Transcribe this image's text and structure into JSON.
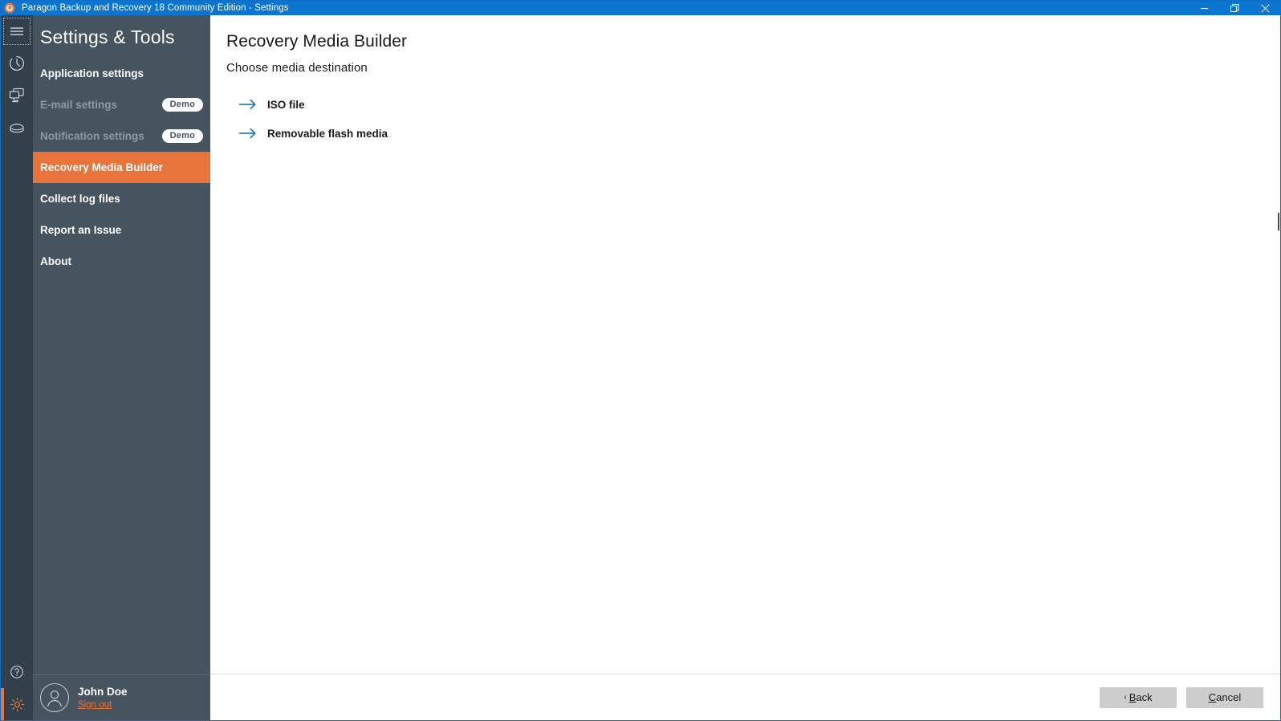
{
  "window": {
    "title": "Paragon Backup and Recovery 18 Community Edition - Settings",
    "app_icon": "paragon-logo-icon",
    "controls": {
      "minimize": "minimize-icon",
      "restore": "restore-icon",
      "close": "close-icon"
    },
    "accent_titlebar": "#0a76d2"
  },
  "icon_rail": {
    "top_items": [
      {
        "name": "menu-toggle",
        "icon": "hamburger-menu-icon",
        "focused": true
      },
      {
        "name": "history",
        "icon": "clock-history-icon",
        "focused": false
      },
      {
        "name": "backup-jobs",
        "icon": "monitor-screens-icon",
        "focused": false
      },
      {
        "name": "disks",
        "icon": "disk-drive-icon",
        "focused": false
      }
    ],
    "bottom_items": [
      {
        "name": "help",
        "icon": "help-question-icon",
        "active": false
      },
      {
        "name": "settings",
        "icon": "gear-icon",
        "active": true
      }
    ],
    "accent_color": "#e8743b"
  },
  "sidebar": {
    "heading": "Settings & Tools",
    "background": "#46545f",
    "active_color": "#e8743b",
    "items": [
      {
        "label": "Application settings",
        "state": "enabled",
        "badge": null
      },
      {
        "label": "E-mail settings",
        "state": "disabled",
        "badge": "Demo"
      },
      {
        "label": "Notification settings",
        "state": "disabled",
        "badge": "Demo"
      },
      {
        "label": "Recovery Media Builder",
        "state": "active",
        "badge": null
      },
      {
        "label": "Collect log files",
        "state": "enabled",
        "badge": null
      },
      {
        "label": "Report an Issue",
        "state": "enabled",
        "badge": null
      },
      {
        "label": "About",
        "state": "enabled",
        "badge": null
      }
    ],
    "user": {
      "name": "John Doe",
      "sign_out_label": "Sign out",
      "avatar_icon": "user-avatar-icon"
    }
  },
  "main": {
    "title": "Recovery Media Builder",
    "subtitle": "Choose media destination",
    "arrow_color": "#0a6cc4",
    "options": [
      {
        "label": "ISO file",
        "icon": "arrow-right-icon"
      },
      {
        "label": "Removable flash media",
        "icon": "arrow-right-icon"
      }
    ]
  },
  "footer": {
    "back_prefix": "‹ ",
    "back_accel": "B",
    "back_rest": "ack",
    "cancel_accel": "C",
    "cancel_rest": "ancel"
  }
}
